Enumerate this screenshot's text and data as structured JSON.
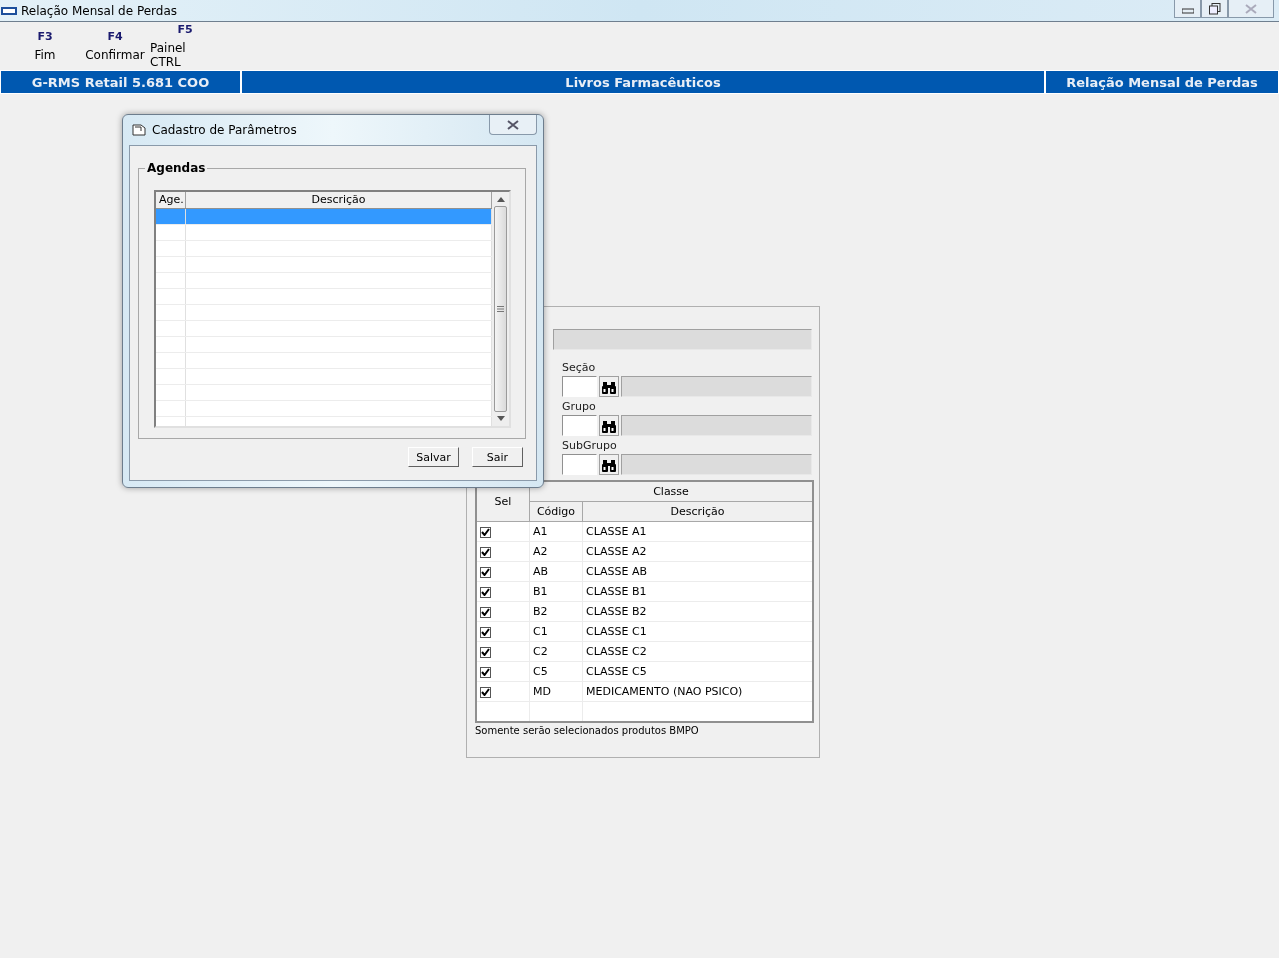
{
  "window": {
    "title": "Relação Mensal de Perdas"
  },
  "toolbar": [
    {
      "key": "F3",
      "label": "Fim"
    },
    {
      "key": "F4",
      "label": "Confirmar"
    },
    {
      "key": "F5",
      "label": "Painel CTRL"
    }
  ],
  "header_bar": [
    "G-RMS Retail 5.681 COO",
    "Livros Farmacêuticos",
    "Relação Mensal de Perdas"
  ],
  "filter_panel": {
    "fields": [
      {
        "label": "Seção"
      },
      {
        "label": "Grupo"
      },
      {
        "label": "SubGrupo"
      }
    ],
    "grid": {
      "group_header": "Classe",
      "columns": [
        "Sel",
        "Código",
        "Descrição"
      ],
      "rows": [
        {
          "checked": true,
          "code": "A1",
          "description": "CLASSE A1"
        },
        {
          "checked": true,
          "code": "A2",
          "description": "CLASSE A2"
        },
        {
          "checked": true,
          "code": "AB",
          "description": "CLASSE AB"
        },
        {
          "checked": true,
          "code": "B1",
          "description": "CLASSE B1"
        },
        {
          "checked": true,
          "code": "B2",
          "description": "CLASSE B2"
        },
        {
          "checked": true,
          "code": "C1",
          "description": "CLASSE C1"
        },
        {
          "checked": true,
          "code": "C2",
          "description": "CLASSE C2"
        },
        {
          "checked": true,
          "code": "C5",
          "description": "CLASSE C5"
        },
        {
          "checked": true,
          "code": "MD",
          "description": "MEDICAMENTO (NAO PSICO)"
        }
      ]
    },
    "note": "Somente serão selecionados produtos BMPO"
  },
  "dialog": {
    "title": "Cadastro de Parâmetros",
    "group": "Agendas",
    "columns": [
      "Age.",
      "Descrição"
    ],
    "rows": [
      {
        "selected": true
      },
      {
        "selected": false
      },
      {
        "selected": false
      },
      {
        "selected": false
      },
      {
        "selected": false
      },
      {
        "selected": false
      },
      {
        "selected": false
      },
      {
        "selected": false
      },
      {
        "selected": false
      },
      {
        "selected": false
      },
      {
        "selected": false
      },
      {
        "selected": false
      },
      {
        "selected": false
      },
      {
        "selected": false
      }
    ],
    "buttons": [
      "Salvar",
      "Sair"
    ]
  }
}
